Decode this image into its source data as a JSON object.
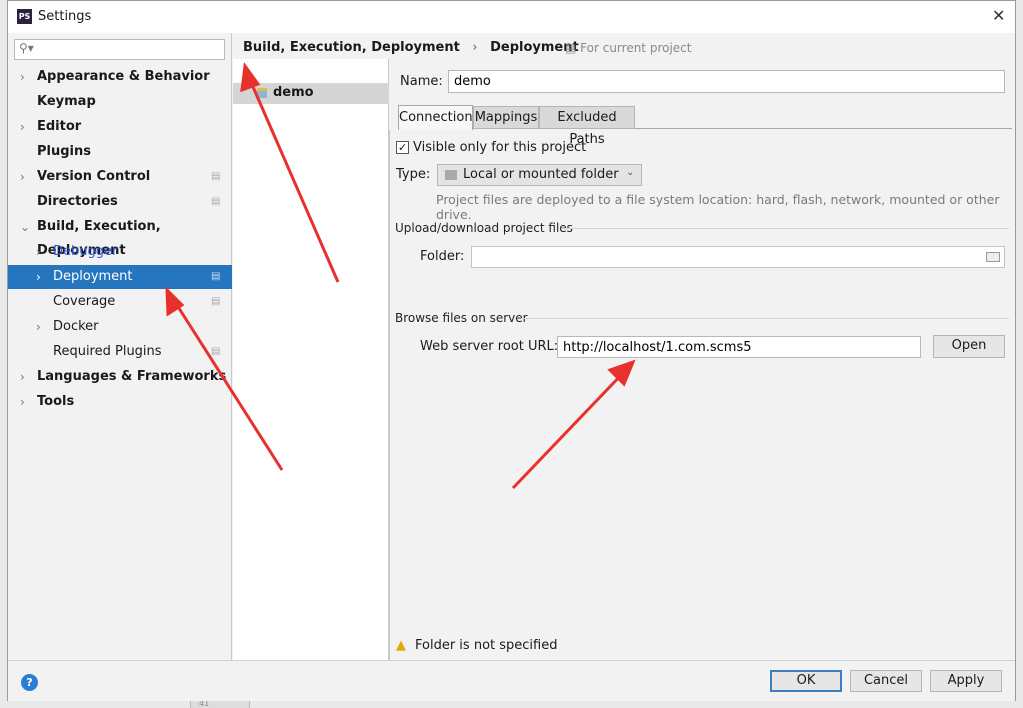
{
  "window": {
    "title": "Settings",
    "close": "✕",
    "app_icon": "PS"
  },
  "search": {
    "placeholder": "",
    "icon": "search-icon"
  },
  "sidebar": {
    "items": [
      {
        "label": "Appearance & Behavior",
        "expandable": true
      },
      {
        "label": "Keymap",
        "expandable": false
      },
      {
        "label": "Editor",
        "expandable": true
      },
      {
        "label": "Plugins",
        "expandable": false
      },
      {
        "label": "Version Control",
        "expandable": true,
        "project": true
      },
      {
        "label": "Directories",
        "expandable": false,
        "project": true
      },
      {
        "label": "Build, Execution, Deployment",
        "expandable": true,
        "expanded": true
      },
      {
        "label": "Debugger",
        "expandable": true,
        "child": true
      },
      {
        "label": "Deployment",
        "expandable": true,
        "child": true,
        "selected": true,
        "project": true
      },
      {
        "label": "Coverage",
        "expandable": false,
        "child": true,
        "project": true
      },
      {
        "label": "Docker",
        "expandable": true,
        "child": true
      },
      {
        "label": "Required Plugins",
        "expandable": false,
        "child": true,
        "project": true
      },
      {
        "label": "Languages & Frameworks",
        "expandable": true
      },
      {
        "label": "Tools",
        "expandable": true
      }
    ]
  },
  "breadcrumb": {
    "parent": "Build, Execution, Deployment",
    "sep": "›",
    "current": "Deployment",
    "scope": "For current project"
  },
  "toolbar": {
    "add": "+",
    "remove": "−",
    "copy": "copy-icon",
    "apply": "✓"
  },
  "servers": [
    {
      "name": "demo"
    }
  ],
  "form": {
    "name_label": "Name:",
    "name_value": "demo",
    "tabs": [
      "Connection",
      "Mappings",
      "Excluded Paths"
    ],
    "active_tab": 0,
    "visible_label": "Visible only for this project",
    "visible_checked": true,
    "type_label": "Type:",
    "type_value": "Local or mounted folder",
    "type_hint": "Project files are deployed to a file system location: hard, flash, network, mounted or other drive.",
    "upload_section": "Upload/download project files",
    "folder_label": "Folder:",
    "folder_value": "",
    "browse_section": "Browse files on server",
    "url_label": "Web server root URL:",
    "url_value": "http://localhost/1.com.scms5",
    "open_button": "Open",
    "warning": "Folder is not specified"
  },
  "footer": {
    "help": "?",
    "ok": "OK",
    "cancel": "Cancel",
    "apply": "Apply"
  },
  "background": {
    "line_number": "41"
  },
  "colors": {
    "selection": "#2675bf",
    "link": "#2a5bd7",
    "arrow": "#e8312d",
    "focus": "#3c7fc1"
  }
}
